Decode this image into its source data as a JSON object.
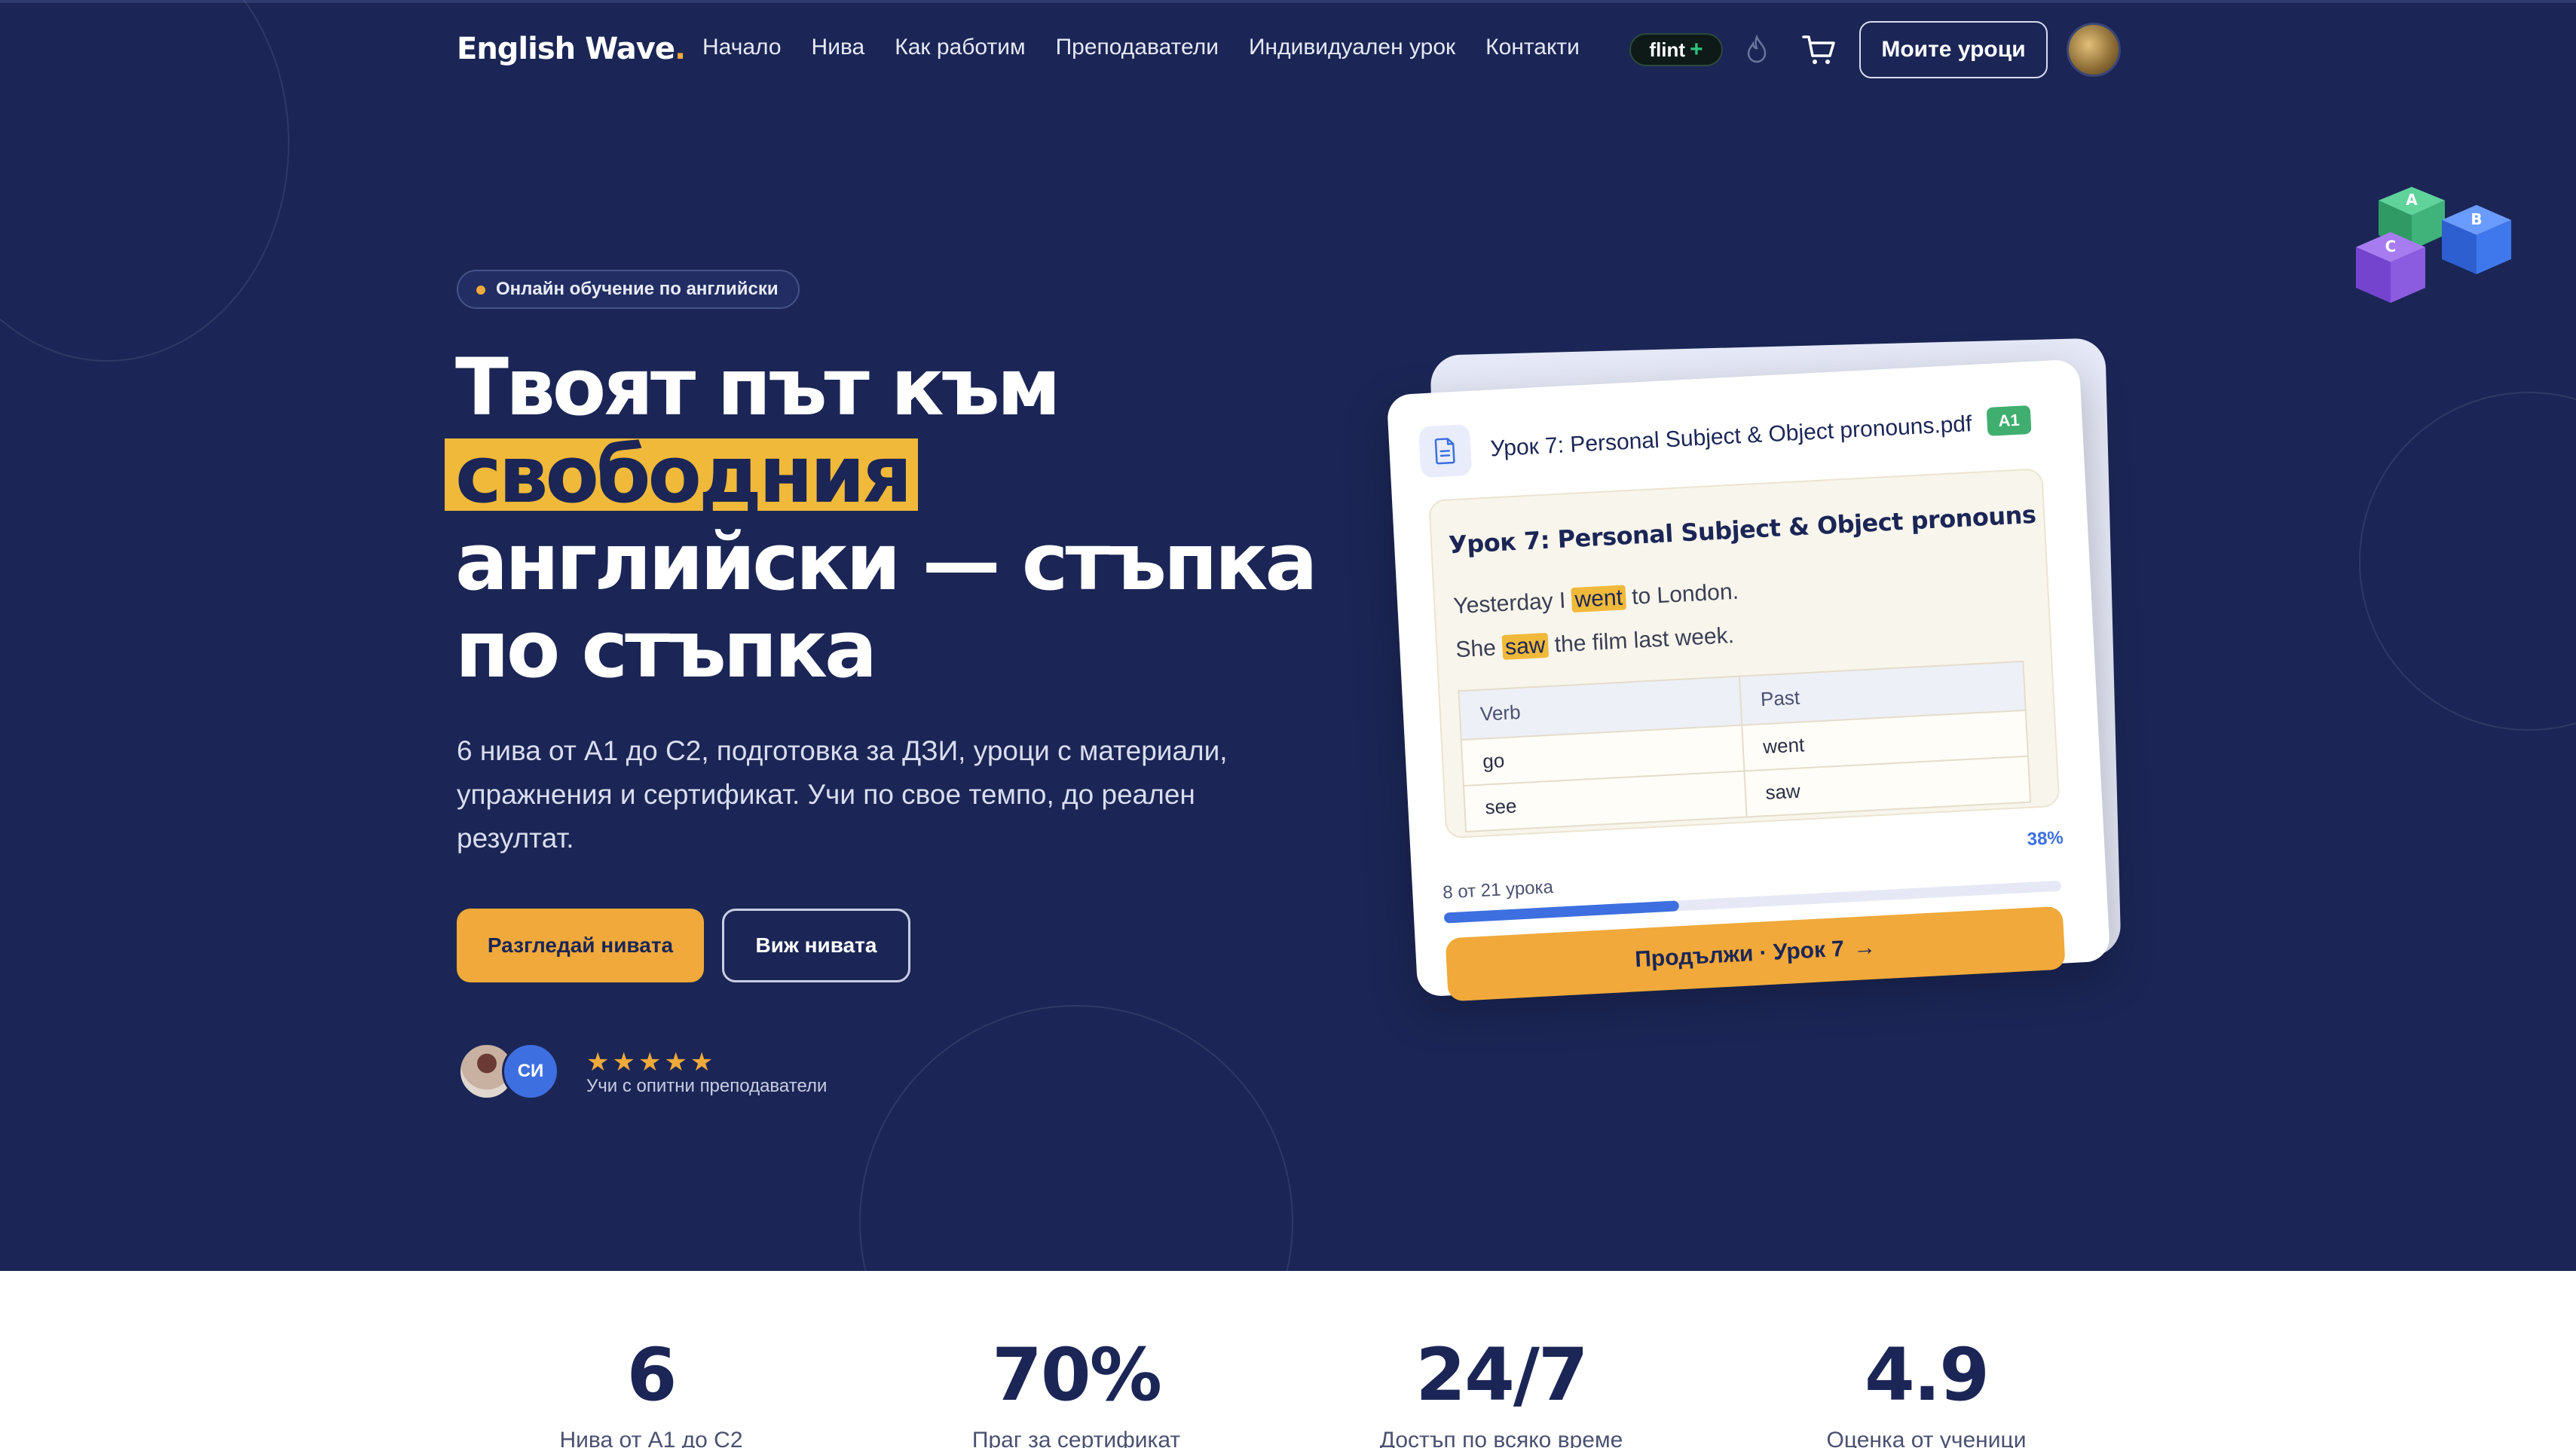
{
  "nav": {
    "logo": "English Wave",
    "logo_dot": ".",
    "links": [
      "Начало",
      "Нива",
      "Как работим",
      "Преподаватели",
      "Индивидуален урок",
      "Контакти"
    ],
    "flint_label": "flint",
    "flint_plus": "+",
    "my_lessons": "Моите уроци"
  },
  "hero": {
    "pill": "Онлайн обучение по английски",
    "headline_line1": "Твоят път към",
    "headline_highlight": "свободния",
    "headline_line3": "английски — стъпка",
    "headline_line4": "по стъпка",
    "description": "6 нива от А1 до С2, подготовка за ДЗИ, уроци с материали, упражнения и сертификат. Учи по свое темпо, до реален резултат.",
    "primary_button": "Разгледай нивата",
    "secondary_button": "Виж нивата",
    "avatar_initials": "СИ",
    "stars": "★★★★★",
    "rating_count": 5,
    "social_text": "Учи с опитни преподаватели"
  },
  "lesson_card": {
    "file_name": "Урок 7: Personal Subject & Object pronouns.pdf",
    "level": "A1",
    "preview_title": "Урок 7: Personal Subject & Object pronouns",
    "sentence1_before": "Yesterday I",
    "sentence1_highlight": "went",
    "sentence1_after": "to London.",
    "sentence2_before": "She",
    "sentence2_highlight": "saw",
    "sentence2_after": "the film last week.",
    "table_headers": [
      "Verb",
      "Past"
    ],
    "table_rows": [
      [
        "go",
        "went"
      ],
      [
        "see",
        "saw"
      ]
    ],
    "progress_text": "8 от 21 урока",
    "progress_percent": "38%",
    "progress_value": 0.38,
    "continue_button": "Продължи · Урок 7",
    "continue_arrow": "→"
  },
  "stats": [
    {
      "value": "6",
      "label": "Нива от А1 до С2"
    },
    {
      "value": "70%",
      "label": "Праг за сертификат"
    },
    {
      "value": "24/7",
      "label": "Достъп по всяко време"
    },
    {
      "value": "4.9",
      "label": "Оценка от ученици"
    }
  ],
  "icons": {
    "file": "document-icon",
    "cart": "cart-icon",
    "flame": "flame-icon",
    "cubes": "abc-cubes-icon"
  },
  "colors": {
    "navy": "#1b2656",
    "accent": "#f0a93a",
    "blue": "#3d6fe0",
    "green": "#3fae6f"
  }
}
